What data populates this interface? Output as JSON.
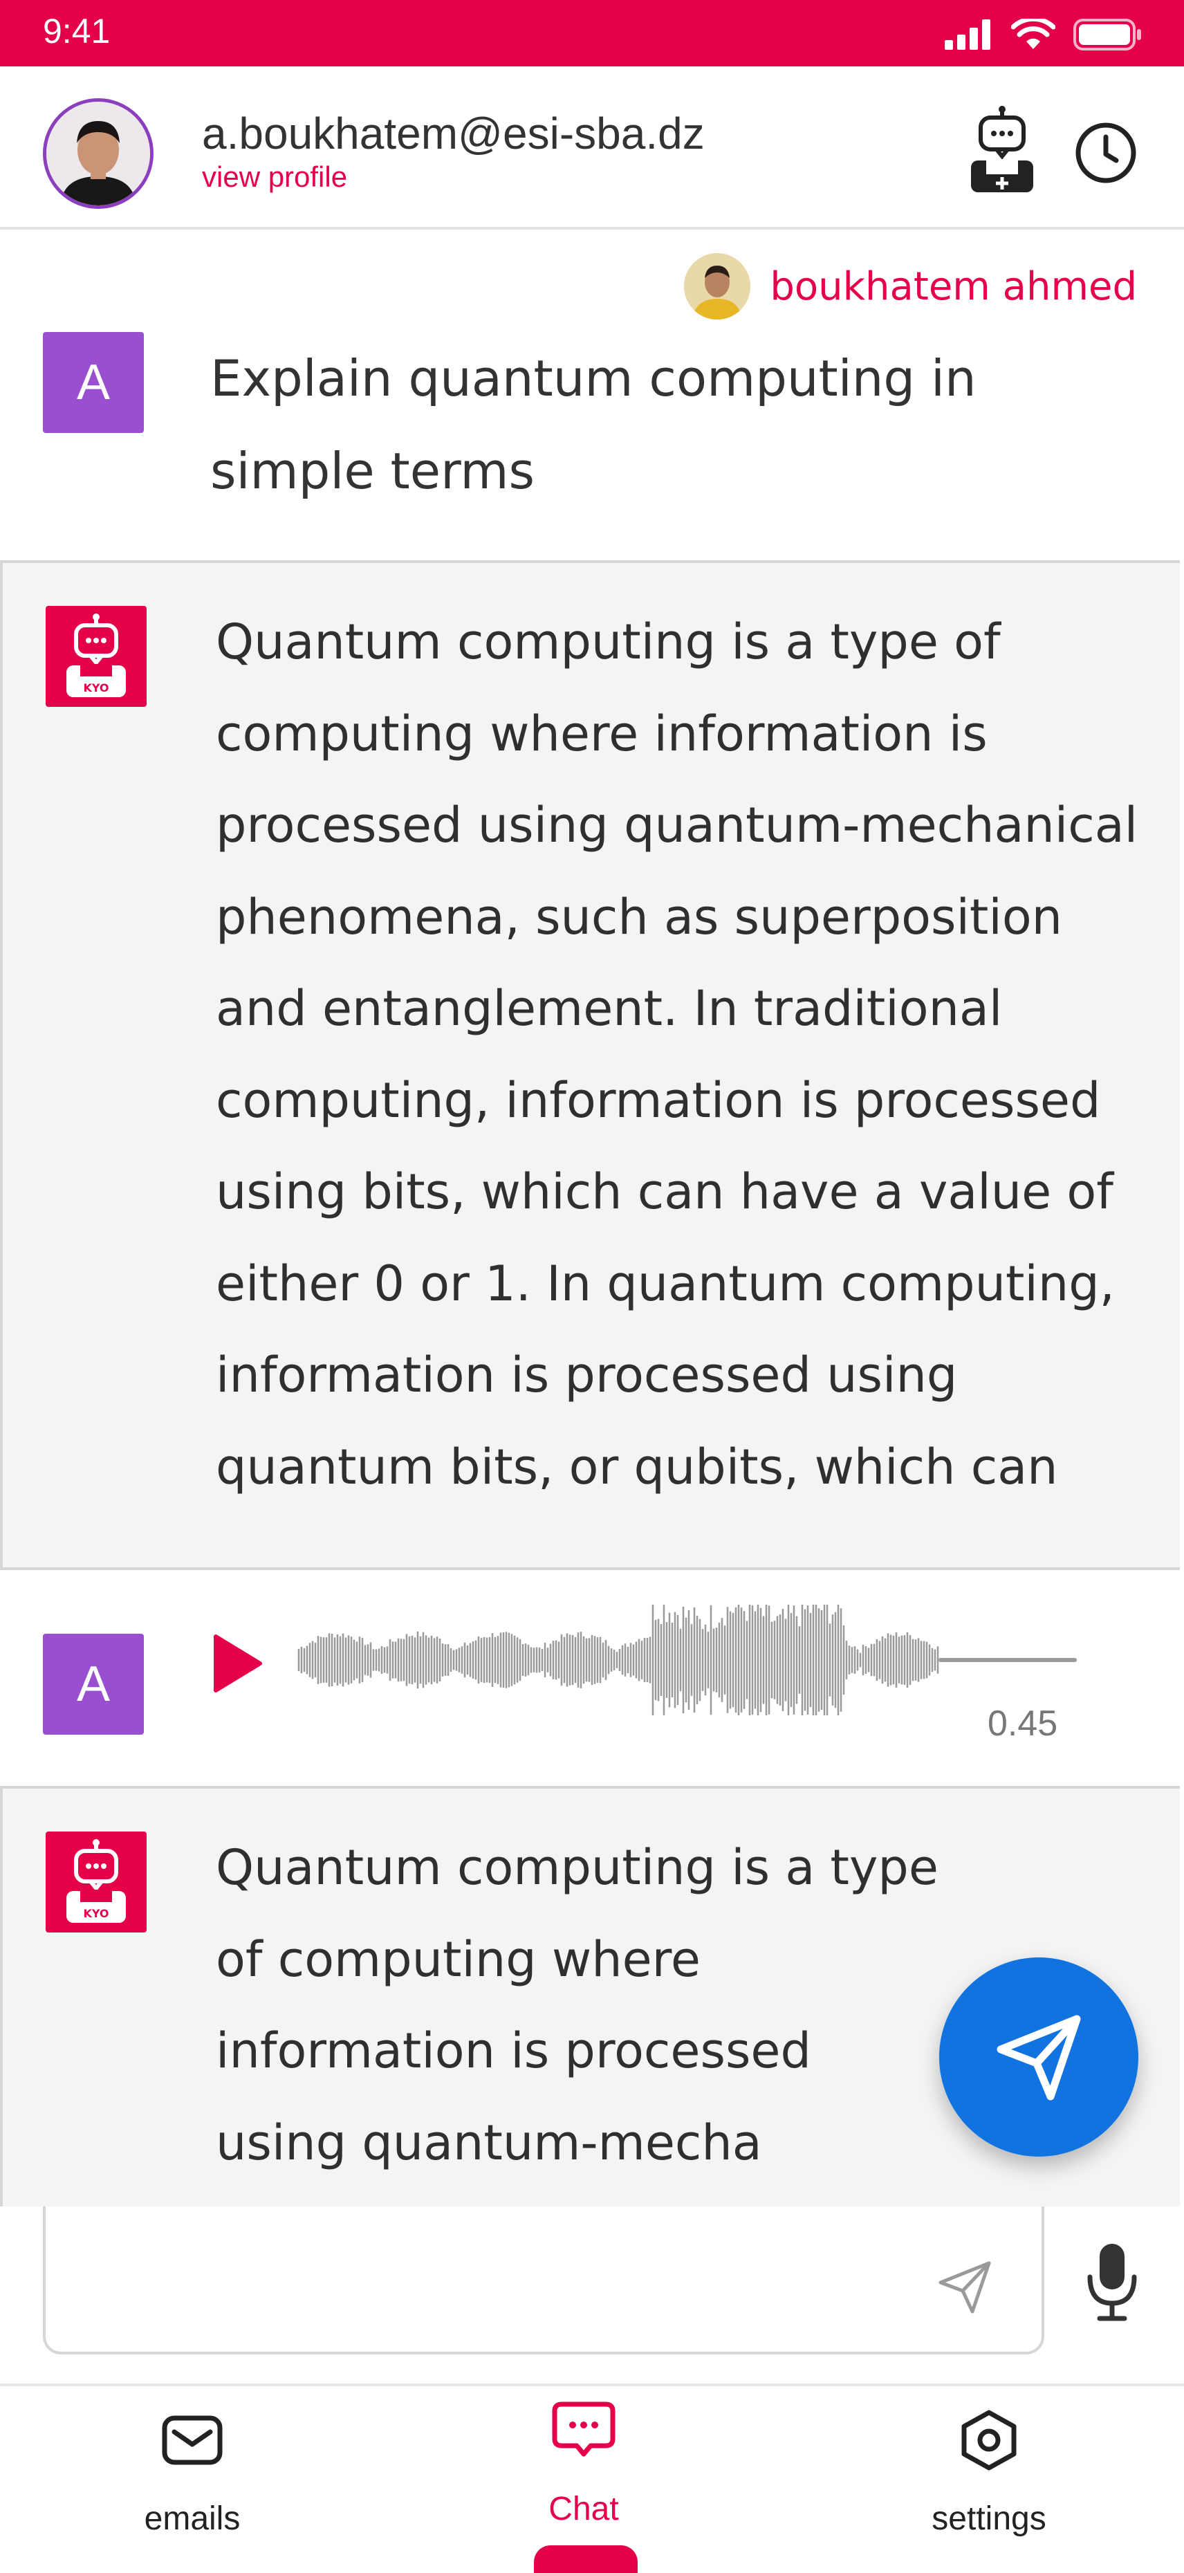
{
  "colors": {
    "brand": "#E5004A",
    "user_avatar": "#9A4FD0",
    "fab": "#1073E0",
    "bot_bubble": "#f4f4f5"
  },
  "status_bar": {
    "time": "9:41",
    "icons": [
      "signal-icon",
      "wifi-icon",
      "battery-icon"
    ]
  },
  "header": {
    "email": "a.boukhatem@esi-sba.dz",
    "view_profile": "view profile",
    "actions": [
      "new-chat-bot-icon",
      "history-clock-icon"
    ]
  },
  "chat": {
    "sender_name": "boukhatem ahmed",
    "user_initial": "A",
    "user_message": "Explain quantum computing in simple terms",
    "bot_response_1": "Quantum computing is a type of computing where information is processed using quantum-mechanical phenomena, such as superposition and entanglement. In traditional computing, information is processed using bits, which can have a value of either 0 or 1. In quantum computing, information is processed using quantum bits, or qubits, which can",
    "audio_message": {
      "duration": "0.45",
      "played_fraction": 0.0
    },
    "bot_response_2": "Quantum computing is a type of computing where information is processed using quantum-mecha"
  },
  "input": {
    "value": "",
    "placeholder": ""
  },
  "bottom_nav": {
    "items": [
      {
        "label": "emails",
        "icon": "mail-icon"
      },
      {
        "label": "Chat",
        "icon": "chat-bubble-icon",
        "active": true
      },
      {
        "label": "settings",
        "icon": "settings-hexagon-icon"
      }
    ]
  }
}
